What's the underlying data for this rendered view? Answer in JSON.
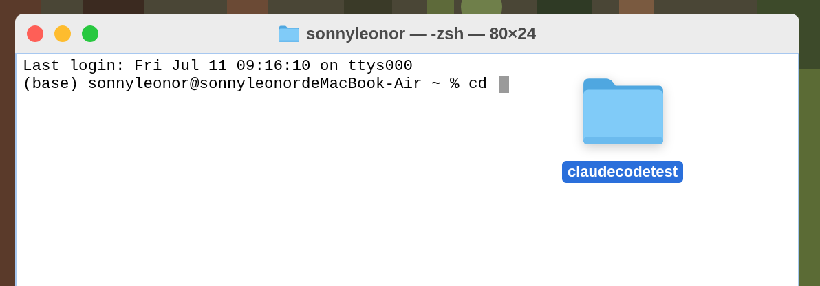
{
  "window": {
    "title": "sonnyleonor — -zsh — 80×24"
  },
  "terminal": {
    "lines": [
      "Last login: Fri Jul 11 09:16:10 on ttys000",
      "(base) sonnyleonor@sonnyleonordeMacBook-Air ~ % cd "
    ]
  },
  "dragged_item": {
    "label": "claudecodetest",
    "selected": true
  }
}
